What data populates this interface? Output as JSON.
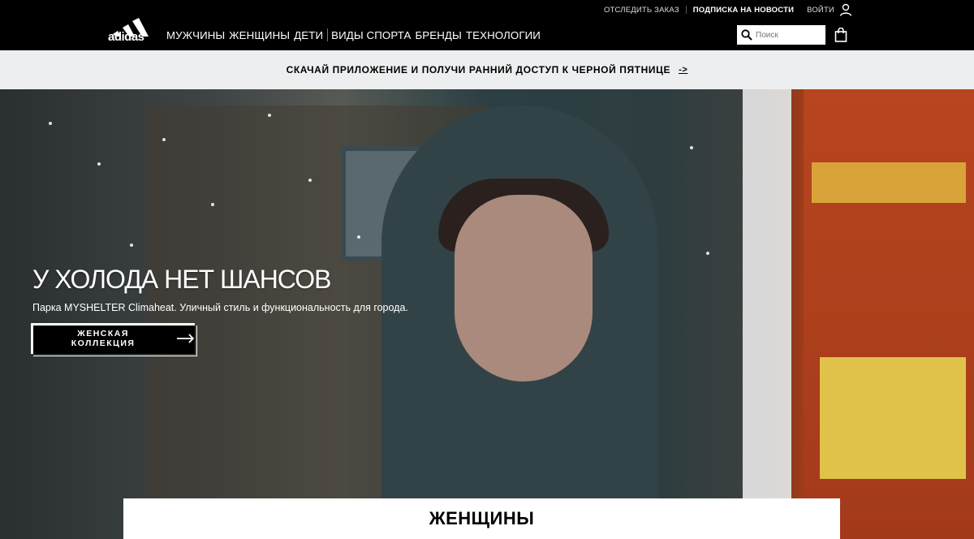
{
  "utility_links": {
    "track_order": "ОТСЛЕДИТЬ ЗАКАЗ",
    "newsletter": "ПОДПИСКА НА НОВОСТИ",
    "login": "ВОЙТИ"
  },
  "header": {
    "logo_text": "adidas",
    "nav": [
      "МУЖЧИНЫ",
      "ЖЕНЩИНЫ",
      "ДЕТИ",
      "ВИДЫ СПОРТА",
      "БРЕНДЫ",
      "ТЕХНОЛОГИИ"
    ],
    "search_placeholder": "Поиск",
    "search_icon": "search-icon",
    "bag_icon": "shopping-bag-icon"
  },
  "promo": {
    "text": "СКАЧАЙ ПРИЛОЖЕНИЕ И ПОЛУЧИ РАННИЙ ДОСТУП К ЧЕРНОЙ ПЯТНИЦЕ",
    "arrow": "->"
  },
  "hero": {
    "title": "У ХОЛОДА НЕТ ШАНСОВ",
    "subtitle": "Парка MYSHELTER Climaheat. Уличный стиль и функциональность для города.",
    "cta_label": "ЖЕНСКАЯ КОЛЛЕКЦИЯ"
  },
  "section": {
    "title": "ЖЕНЩИНЫ"
  },
  "colors": {
    "brand_black": "#000000",
    "promo_bg": "#eceeef",
    "text_white": "#ffffff"
  }
}
